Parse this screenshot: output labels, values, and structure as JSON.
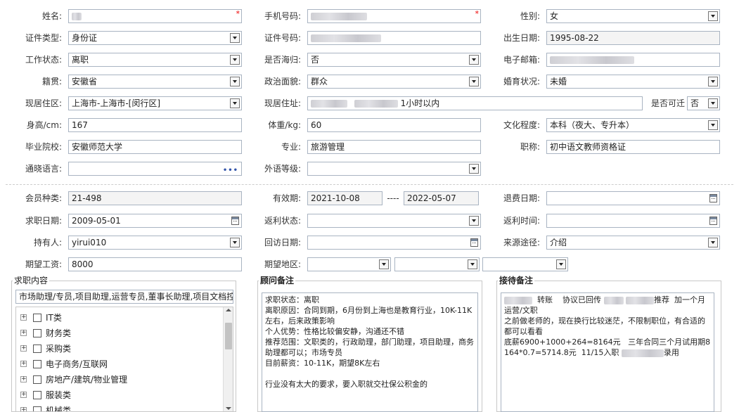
{
  "basic": {
    "name_label": "姓名:",
    "phone_label": "手机号码:",
    "gender_label": "性别:",
    "gender_value": "女",
    "id_type_label": "证件类型:",
    "id_type_value": "身份证",
    "id_no_label": "证件号码:",
    "birth_label": "出生日期:",
    "birth_value": "1995-08-22",
    "work_status_label": "工作状态:",
    "work_status_value": "离职",
    "overseas_label": "是否海归:",
    "overseas_value": "否",
    "email_label": "电子邮箱:",
    "native_label": "籍贯:",
    "native_value": "安徽省",
    "political_label": "政治面貌:",
    "political_value": "群众",
    "marital_label": "婚育状况:",
    "marital_value": "未婚",
    "area_label": "现居住区:",
    "area_value": "上海市-上海市-[闵行区]",
    "address_label": "现居住址:",
    "address_value": "1小时以内",
    "relocate_label": "是否可迁",
    "relocate_value": "否",
    "height_label": "身高/cm:",
    "height_value": "167",
    "weight_label": "体重/kg:",
    "weight_value": "60",
    "education_label": "文化程度:",
    "education_value": "本科（夜大、专升本）",
    "school_label": "毕业院校:",
    "school_value": "安徽师范大学",
    "major_label": "专业:",
    "major_value": "旅游管理",
    "title_label": "职称:",
    "title_value": "初中语文教师资格证",
    "language_label": "通晓语言:",
    "foreign_label": "外语等级:"
  },
  "membership": {
    "member_type_label": "会员种类:",
    "member_type_value": "21-498",
    "valid_label": "有效期:",
    "valid_from": "2021-10-08",
    "valid_sep": "----",
    "valid_to": "2022-05-07",
    "refund_label": "退费日期:",
    "job_date_label": "求职日期:",
    "job_date_value": "2009-05-01",
    "rebate_status_label": "返利状态:",
    "rebate_time_label": "返利时间:",
    "holder_label": "持有人:",
    "holder_value": "yirui010",
    "visit_label": "回访日期:",
    "source_label": "来源途径:",
    "source_value": "介绍",
    "salary_label": "期望工资:",
    "salary_value": "8000",
    "region_label": "期望地区:"
  },
  "job_panel": {
    "title": "求职内容",
    "summary": "市场助理/专员,项目助理,运营专员,董事长助理,项目文档控",
    "categories": [
      "IT类",
      "财务类",
      "采购类",
      "电子商务/互联网",
      "房地产/建筑/物业管理",
      "服装类",
      "机械类"
    ]
  },
  "advisor_panel": {
    "title": "顾问备注",
    "lines": [
      "求职状态：离职",
      "离职原因：合同到期，6月份到上海也是教育行业，10K-11K左右，后来政策影响",
      "个人优势：性格比较偏安静，沟通还不错",
      "推荐范围：文职类的，行政助理，部门助理，项目助理，商务助理都可以；市场专员",
      "目前薪资：10-11K，期望8K左右",
      "",
      "行业没有太大的要求，要入职就交社保公积金的"
    ]
  },
  "reception_panel": {
    "title": "接待备注",
    "line1_a": "转账",
    "line1_b": "协议已回传",
    "line1_c": "推荐",
    "line1_d": "加一个月",
    "line2": "运营/文职",
    "line3": "之前做老师的，现在换行比较迷茫，不限制职位，有合适的都可以看看",
    "line4": "底薪6900+1000+264=8164元   三年合同三个月试用期8164*0.7=5714.8元  11/15入职",
    "line4_end": "录用"
  }
}
